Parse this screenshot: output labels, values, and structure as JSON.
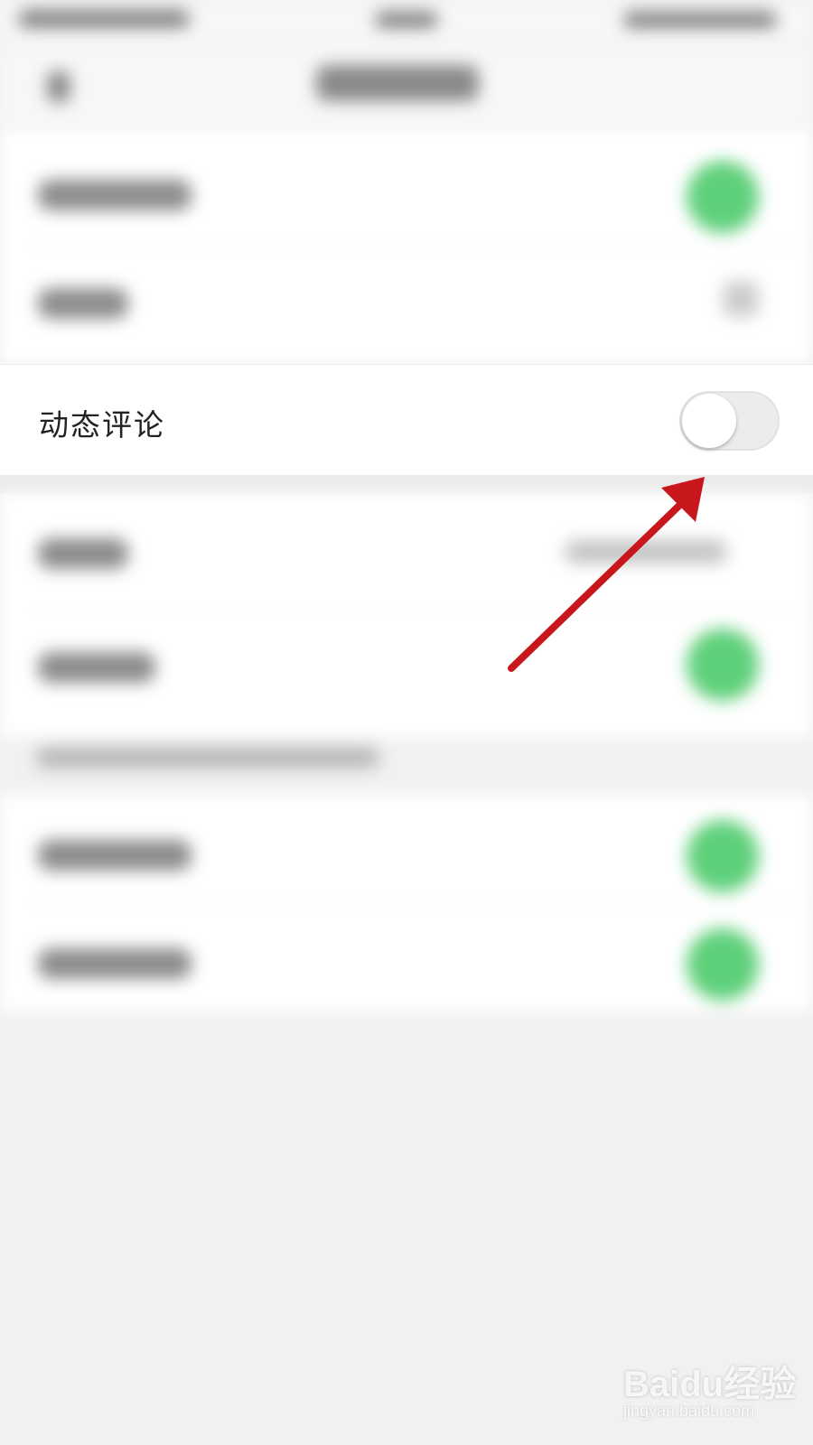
{
  "setting": {
    "label": "动态评论",
    "toggle_state": "off"
  },
  "colors": {
    "toggle_on": "#5fd07a",
    "toggle_off": "#ececec",
    "arrow": "#c8161d"
  },
  "watermark": {
    "logo": "Baidu经验",
    "url": "jingyan.baidu.com"
  }
}
